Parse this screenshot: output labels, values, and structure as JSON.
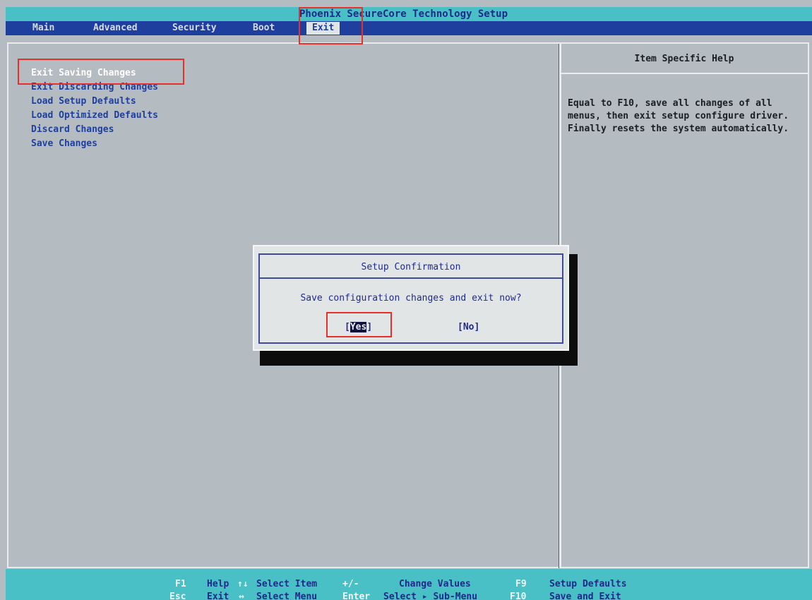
{
  "title": "Phoenix SecureCore Technology Setup",
  "menu": {
    "items": [
      {
        "label": "Main"
      },
      {
        "label": "Advanced"
      },
      {
        "label": "Security"
      },
      {
        "label": "Boot"
      },
      {
        "label": "Exit",
        "active": true
      }
    ]
  },
  "exit_menu": {
    "options": [
      {
        "label": "Exit Saving Changes",
        "selected": true
      },
      {
        "label": "Exit Discarding Changes"
      },
      {
        "label": "Load Setup Defaults"
      },
      {
        "label": "Load Optimized Defaults"
      },
      {
        "label": "Discard Changes"
      },
      {
        "label": "Save Changes"
      }
    ]
  },
  "help_panel": {
    "title": "Item Specific Help",
    "text": "Equal to F10,  save all changes of all menus, then exit setup configure driver. Finally resets the system automatically."
  },
  "dialog": {
    "title": "Setup Confirmation",
    "message": "Save configuration changes and exit now?",
    "yes_open": "[",
    "yes_label": "Yes",
    "yes_close": "]",
    "no_label": "[No]"
  },
  "status_bar": {
    "row1": [
      {
        "key": "F1",
        "desc": "Help"
      },
      {
        "key": "↑↓",
        "desc": "Select Item"
      },
      {
        "key": "+/-",
        "desc": "Change Values"
      },
      {
        "key": "F9",
        "desc": "Setup Defaults"
      }
    ],
    "row2": [
      {
        "key": "Esc",
        "desc": "Exit"
      },
      {
        "key": "↔",
        "desc": "Select Menu"
      },
      {
        "key": "Enter",
        "desc": "Select ▸ Sub-Menu"
      },
      {
        "key": "F10",
        "desc": "Save and Exit"
      }
    ]
  },
  "colors": {
    "background": "#b4bcc2",
    "title_bar": "#49c0c6",
    "menu_bar": "#1f3f9e",
    "highlight_annotation": "#e8302a"
  }
}
